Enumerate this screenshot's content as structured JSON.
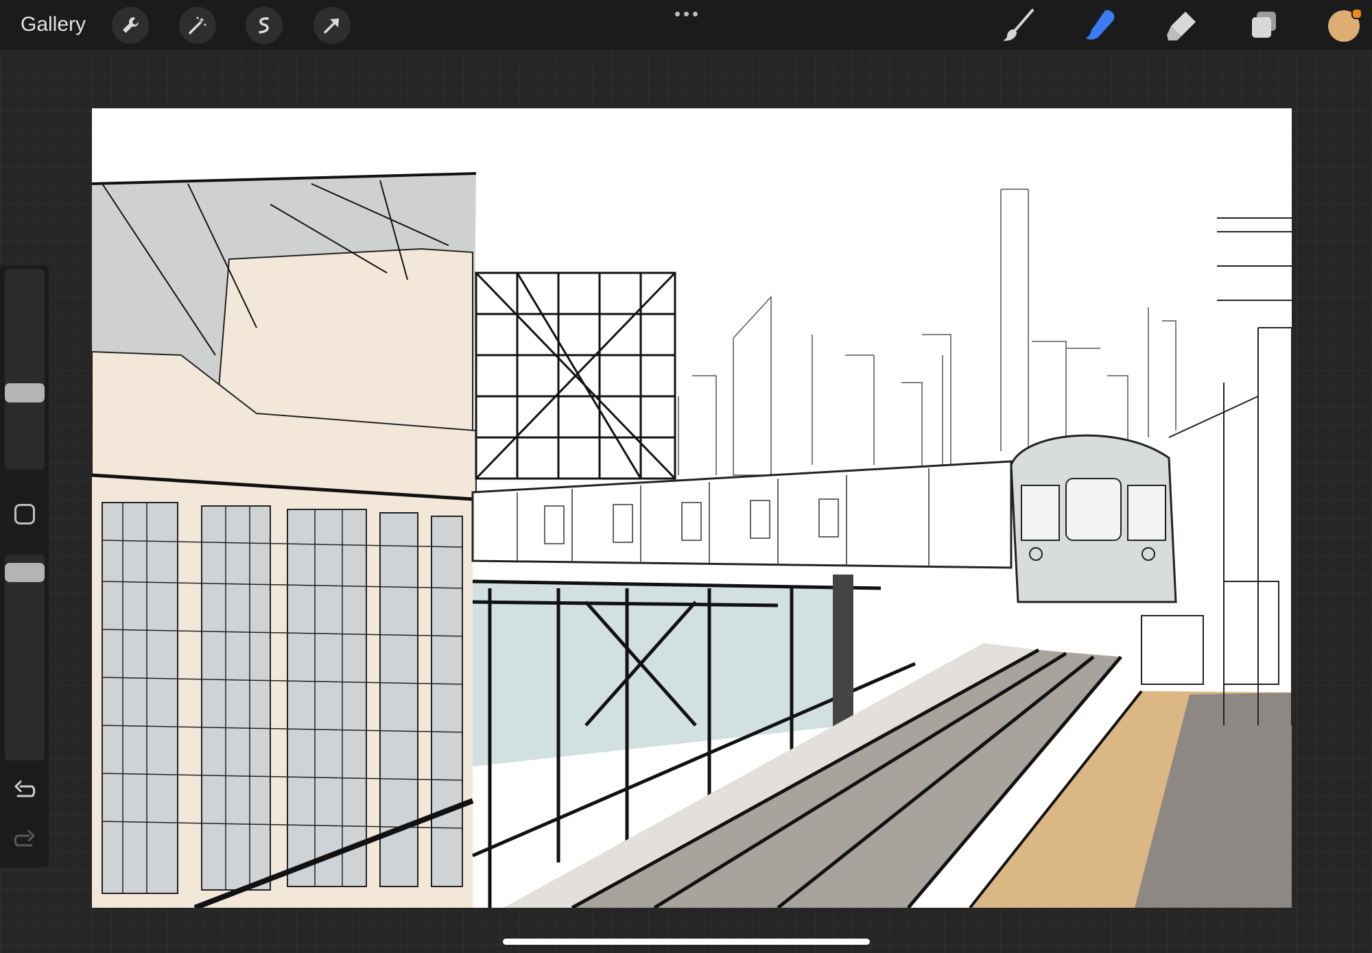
{
  "topbar": {
    "gallery_label": "Gallery",
    "left_tools": [
      "wrench-icon",
      "magic-wand-icon",
      "selection-icon",
      "transform-arrow-icon"
    ],
    "right_tools": [
      "brush-icon",
      "smudge-icon",
      "eraser-icon",
      "layers-icon"
    ],
    "active_tool": "smudge-icon",
    "accent_color": "#3d7bf5",
    "current_color": "#dcae73"
  },
  "sidebar": {
    "controls": [
      "brush-size-slider",
      "modify-button",
      "opacity-slider",
      "undo-icon",
      "redo-icon"
    ]
  },
  "canvas": {
    "palette": {
      "building_cream": "#f3e7da",
      "sky_gray": "#cfd0d0",
      "track_gray": "#a9a39d",
      "platform_tan": "#dbb784",
      "platform_dark": "#8e8884",
      "structure_blue": "#d3e0e2"
    }
  }
}
